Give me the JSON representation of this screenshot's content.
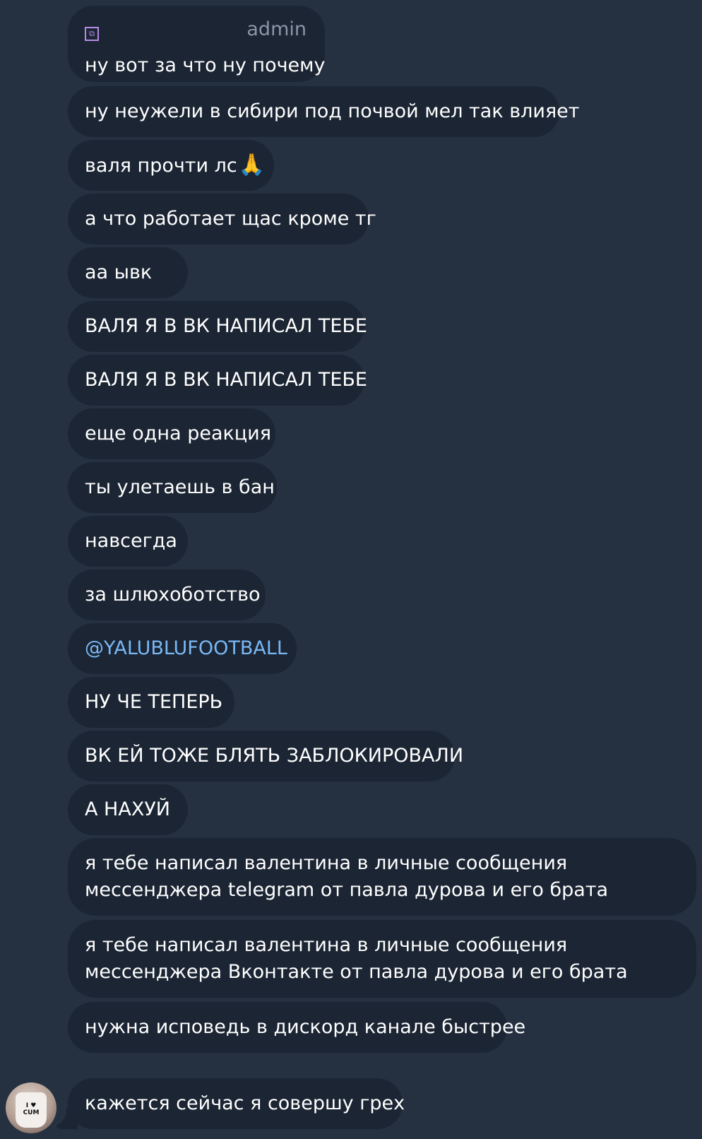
{
  "chat": {
    "sender_label": "admin",
    "sender_emoji_icon": "custom-emoji-icon",
    "avatar_icon": "user-avatar",
    "avatar_text": "I ♥ CUM",
    "messages": [
      {
        "lines": [
          "ну вот за что ну почему"
        ]
      },
      {
        "lines": [
          "ну неужели в сибири под почвой мел так влияет"
        ]
      },
      {
        "lines": [
          "валя прочти лс"
        ],
        "emoji": "🙏"
      },
      {
        "lines": [
          "а что работает щас кроме тг"
        ]
      },
      {
        "lines": [
          "аа ывк"
        ]
      },
      {
        "lines": [
          "ВАЛЯ Я В ВК НАПИСАЛ ТЕБЕ"
        ]
      },
      {
        "lines": [
          "ВАЛЯ Я В ВК НАПИСАЛ ТЕБЕ"
        ]
      },
      {
        "lines": [
          "еще одна реакция"
        ]
      },
      {
        "lines": [
          "ты улетаешь в бан"
        ]
      },
      {
        "lines": [
          "навсегда"
        ]
      },
      {
        "lines": [
          "за шлюхоботство"
        ]
      },
      {
        "lines": [
          "@YALUBLUFOOTBALL"
        ],
        "mention": true
      },
      {
        "lines": [
          "НУ ЧЕ ТЕПЕРЬ"
        ]
      },
      {
        "lines": [
          "ВК ЕЙ ТОЖЕ БЛЯТЬ ЗАБЛОКИРОВАЛИ"
        ]
      },
      {
        "lines": [
          "А НАХУЙ"
        ]
      },
      {
        "lines": [
          "я тебе написал валентина в личные сообщения",
          "мессенджера telegram от павла дурова и его брата"
        ]
      },
      {
        "lines": [
          "я тебе написал валентина в личные сообщения",
          "мессенджера Вконтакте от павла дурова и его брата"
        ]
      },
      {
        "lines": [
          "нужна исповедь в дискорд канале быстрее"
        ]
      },
      {
        "lines": [
          "кажется сейчас я совершу грех"
        ]
      }
    ]
  },
  "colors": {
    "background": "#253040",
    "bubble": "#1b2533",
    "text": "#ffffff",
    "mention": "#79b8f5",
    "admin": "#8a96a6"
  }
}
